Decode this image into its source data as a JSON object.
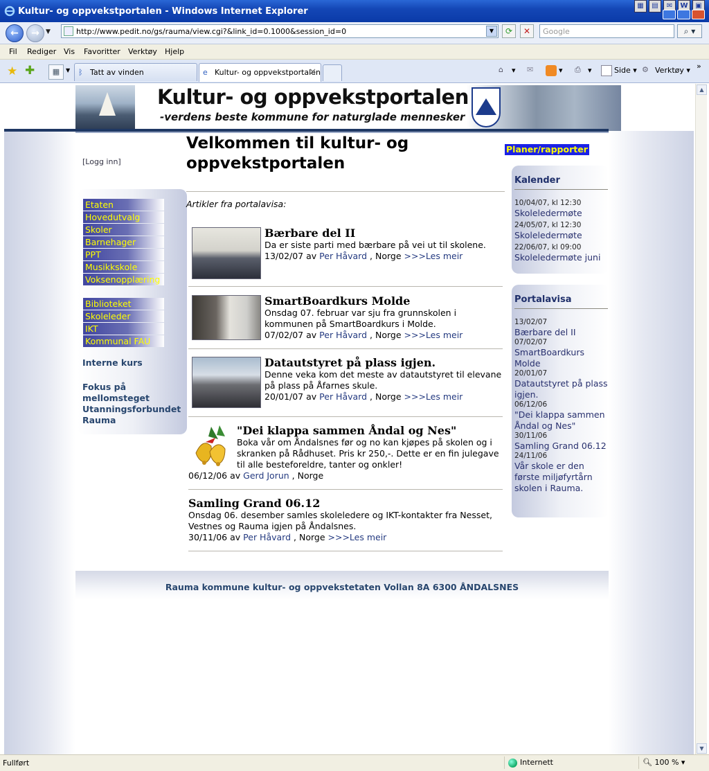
{
  "window": {
    "title": "Kultur- og oppvekstportalen - Windows Internet Explorer"
  },
  "toolbar": {
    "url": "http://www.pedit.no/gs/rauma/view.cgi?&link_id=0.1000&session_id=0",
    "search_placeholder": "Google"
  },
  "menu": [
    "Fil",
    "Rediger",
    "Vis",
    "Favoritter",
    "Verktøy",
    "Hjelp"
  ],
  "tabs": [
    {
      "label": "Tatt av vinden"
    },
    {
      "label": "Kultur- og oppvekstportalen"
    }
  ],
  "commands": {
    "page": "Side",
    "tools": "Verktøy"
  },
  "banner": {
    "title": "Kultur- og oppvekstportalen",
    "tagline": "-verdens beste kommune for naturglade mennesker"
  },
  "left": {
    "login": "[Logg inn]",
    "nav_group_1": [
      "Etaten",
      "Hovedutvalg",
      "Skoler",
      "Barnehager",
      "PPT",
      "Musikkskole",
      "Voksenopplæring"
    ],
    "nav_group_2": [
      "Biblioteket",
      "Skoleleder",
      "IKT",
      "Kommunal FAU"
    ],
    "interne_kurs": "Interne kurs",
    "fokus_line1": "Fokus på",
    "fokus_line2": "mellomsteget",
    "utanning_line1": "Utanningsforbundet",
    "utanning_line2": "Rauma"
  },
  "main": {
    "title": "Velkommen til kultur- og oppvekstportalen",
    "intro": "Artikler fra portalavisa:",
    "articles": [
      {
        "title": "Bærbare del II",
        "text": "Da er siste parti med bærbare på vei ut til skolene.",
        "date": "13/02/07 av",
        "author": "Per Håvard",
        "place": ", Norge",
        "more": ">>>Les meir"
      },
      {
        "title": "SmartBoardkurs Molde",
        "text": "Onsdag 07. februar var sju fra grunnskolen i kommunen på SmartBoardkurs i Molde.",
        "date": "07/02/07 av",
        "author": "Per Håvard",
        "place": ", Norge",
        "more": ">>>Les meir"
      },
      {
        "title": "Datautstyret på plass igjen.",
        "text": "Denne veka kom det meste av datautstyret til elevane på plass på Åfarnes skule.",
        "date": "20/01/07 av",
        "author": "Per Håvard",
        "place": ", Norge",
        "more": ">>>Les meir"
      },
      {
        "title": "\"Dei klappa sammen Åndal og Nes\"",
        "text": "Boka vår om Åndalsnes før og no kan kjøpes på skolen og i skranken på Rådhuset. Pris kr 250,-. Dette er en fin julegave til alle besteforeldre, tanter og onkler!",
        "date": "06/12/06 av",
        "author": "Gerd Jorun",
        "place": ", Norge"
      },
      {
        "title": "Samling Grand 06.12",
        "text": "Onsdag 06. desember samles skoleledere og IKT-kontakter fra Nesset, Vestnes og Rauma igjen på Åndalsnes.",
        "date": "30/11/06 av",
        "author": "Per Håvard",
        "place": ", Norge",
        "more": ">>>Les meir"
      }
    ]
  },
  "right": {
    "planer": "Planer/rapporter",
    "kalender": {
      "title": "Kalender",
      "items": [
        {
          "date": "10/04/07, kl 12:30",
          "label": "Skoleledermøte"
        },
        {
          "date": "24/05/07, kl 12:30",
          "label": "Skoleledermøte"
        },
        {
          "date": "22/06/07, kl 09:00",
          "label": "Skoleledermøte juni"
        }
      ]
    },
    "portalavisa": {
      "title": "Portalavisa",
      "items": [
        {
          "date": "13/02/07",
          "label": "Bærbare del II"
        },
        {
          "date": "07/02/07",
          "label": "SmartBoardkurs Molde"
        },
        {
          "date": "20/01/07",
          "label": "Datautstyret på plass igjen."
        },
        {
          "date": "06/12/06",
          "label": "\"Dei klappa sammen Åndal og Nes\""
        },
        {
          "date": "30/11/06",
          "label": "Samling Grand 06.12"
        },
        {
          "date": "24/11/06",
          "label": "Vår skole er den første miljøfyrtårn skolen i Rauma."
        }
      ]
    }
  },
  "footer": "Rauma kommune kultur- og oppvekstetaten Vollan 8A 6300 ÅNDALSNES",
  "status": {
    "text": "Fullført",
    "zone": "Internett",
    "zoom": "100 %"
  }
}
